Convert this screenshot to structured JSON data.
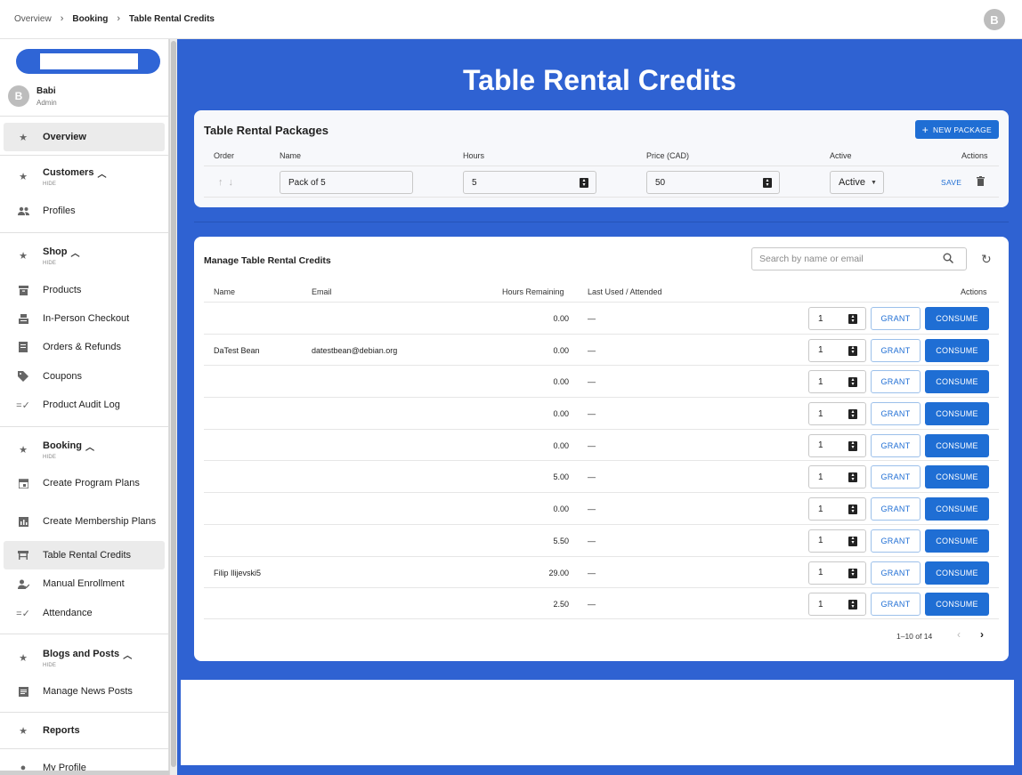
{
  "breadcrumb": [
    "Overview",
    "Booking",
    "Table Rental Credits"
  ],
  "top_avatar": "B",
  "user": {
    "initial": "B",
    "name": "Babi",
    "role": "Admin"
  },
  "sidebar": {
    "overview": "Overview",
    "sections": {
      "customers": {
        "title": "Customers",
        "hide": "HIDE",
        "items": [
          "Profiles"
        ]
      },
      "shop": {
        "title": "Shop",
        "hide": "HIDE",
        "items": [
          "Products",
          "In-Person Checkout",
          "Orders & Refunds",
          "Coupons",
          "Product Audit Log"
        ]
      },
      "booking": {
        "title": "Booking",
        "hide": "HIDE",
        "items": [
          "Create Program Plans",
          "Create Membership Plans",
          "Table Rental Credits",
          "Manual Enrollment",
          "Attendance"
        ]
      },
      "blogs": {
        "title": "Blogs and Posts",
        "hide": "HIDE",
        "items": [
          "Manage News Posts"
        ]
      }
    },
    "reports": "Reports",
    "my_profile": "My Profile"
  },
  "page_title": "Table Rental Credits",
  "packages": {
    "title": "Table Rental Packages",
    "new_button": "NEW PACKAGE",
    "columns": [
      "Order",
      "Name",
      "Hours",
      "Price (CAD)",
      "Active",
      "Actions"
    ],
    "row": {
      "name": "Pack of 5",
      "hours": "5",
      "price": "50",
      "active": "Active",
      "save": "SAVE"
    }
  },
  "credits": {
    "title": "Manage Table Rental Credits",
    "search_placeholder": "Search by name or email",
    "columns": [
      "Name",
      "Email",
      "Hours Remaining",
      "Last Used / Attended",
      "Actions"
    ],
    "grant_label": "GRANT",
    "consume_label": "CONSUME",
    "rows": [
      {
        "name": "",
        "email": "",
        "hours": "0.00",
        "last": "—",
        "qty": "1"
      },
      {
        "name": "DaTest Bean",
        "email": "datestbean@debian.org",
        "hours": "0.00",
        "last": "—",
        "qty": "1"
      },
      {
        "name": "",
        "email": "",
        "hours": "0.00",
        "last": "—",
        "qty": "1"
      },
      {
        "name": "",
        "email": "",
        "hours": "0.00",
        "last": "—",
        "qty": "1"
      },
      {
        "name": "",
        "email": "",
        "hours": "0.00",
        "last": "—",
        "qty": "1"
      },
      {
        "name": "",
        "email": "",
        "hours": "5.00",
        "last": "—",
        "qty": "1"
      },
      {
        "name": "",
        "email": "",
        "hours": "0.00",
        "last": "—",
        "qty": "1"
      },
      {
        "name": "",
        "email": "",
        "hours": "5.50",
        "last": "—",
        "qty": "1"
      },
      {
        "name": "Filip Ilijevski5",
        "email": "",
        "hours": "29.00",
        "last": "—",
        "qty": "1"
      },
      {
        "name": "",
        "email": "",
        "hours": "2.50",
        "last": "—",
        "qty": "1"
      }
    ],
    "pagination": "1–10 of 14"
  }
}
